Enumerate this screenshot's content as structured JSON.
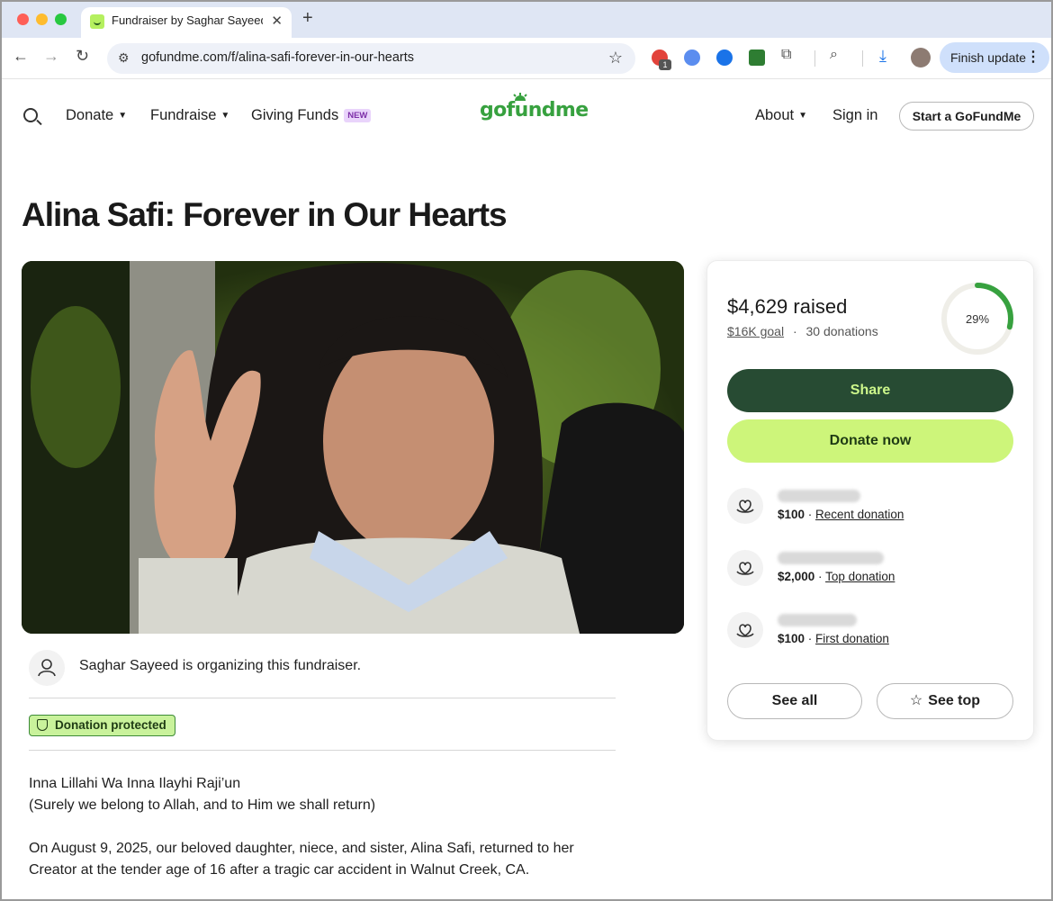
{
  "browser": {
    "tab_title": "Fundraiser by Saghar Sayeed",
    "url": "gofundme.com/f/alina-safi-forever-in-our-hearts",
    "extension_badge": "1",
    "finish_update_label": "Finish update"
  },
  "site_nav": {
    "donate": "Donate",
    "fundraise": "Fundraise",
    "giving_funds": "Giving Funds",
    "new_badge": "NEW",
    "logo": "gofundme",
    "about": "About",
    "sign_in": "Sign in",
    "start": "Start a GoFundMe"
  },
  "fundraiser": {
    "title": "Alina Safi: Forever in Our Hearts",
    "organizer_text": "Saghar Sayeed is organizing this fundraiser.",
    "protected_label": "Donation protected",
    "story_line1": "Inna Lillahi Wa Inna Ilayhi Raji’un",
    "story_line2": "(Surely we belong to Allah, and to Him we shall return)",
    "story_line3": "On August 9, 2025, our beloved daughter, niece, and sister, Alina Safi, returned to her",
    "story_line4": "Creator at the tender age of 16 after a tragic car accident in Walnut Creek, CA."
  },
  "donation_card": {
    "raised": "$4,629 raised",
    "goal": "$16K goal",
    "separator": "·",
    "donations": "30 donations",
    "progress_label": "29%",
    "progress_fraction": 0.29,
    "share_label": "Share",
    "donate_label": "Donate now",
    "donors": [
      {
        "amount": "$100",
        "sep": " · ",
        "kind": "Recent donation"
      },
      {
        "amount": "$2,000",
        "sep": " · ",
        "kind": "Top donation"
      },
      {
        "amount": "$100",
        "sep": " · ",
        "kind": "First donation"
      }
    ],
    "see_all_label": "See all",
    "see_top_label": "See top"
  },
  "colors": {
    "brand_green": "#37a13f",
    "share_bg": "#274b33",
    "donate_bg": "#cdf57a",
    "progress": "#37a13f"
  }
}
